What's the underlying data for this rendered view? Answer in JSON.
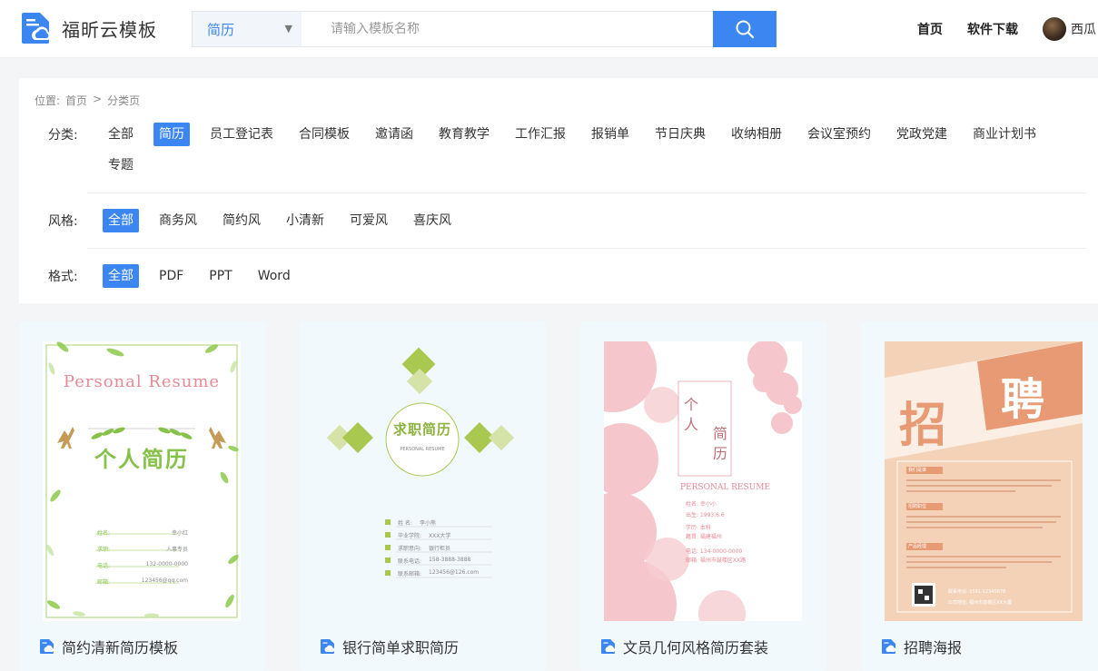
{
  "header": {
    "logo_text": "福昕云模板",
    "search": {
      "category": "简历",
      "placeholder": "请输入模板名称"
    },
    "nav": [
      "首页",
      "软件下载"
    ],
    "username": "西瓜"
  },
  "breadcrumb": {
    "label": "位置:",
    "home": "首页",
    "sep": ">",
    "current": "分类页"
  },
  "filters": {
    "category": {
      "label": "分类:",
      "items": [
        "全部",
        "简历",
        "员工登记表",
        "合同模板",
        "邀请函",
        "教育教学",
        "工作汇报",
        "报销单",
        "节日庆典",
        "收纳相册",
        "会议室预约",
        "党政党建",
        "商业计划书",
        "专题"
      ],
      "active": 1
    },
    "style": {
      "label": "风格:",
      "items": [
        "全部",
        "商务风",
        "简约风",
        "小清新",
        "可爱风",
        "喜庆风"
      ],
      "active": 0
    },
    "format": {
      "label": "格式:",
      "items": [
        "全部",
        "PDF",
        "PPT",
        "Word"
      ],
      "active": 0
    }
  },
  "cards": [
    {
      "title": "简约清新简历模板",
      "thumb": {
        "heading": "Personal Resume",
        "main": "个人简历",
        "rows": [
          [
            "姓名:",
            "幸小红"
          ],
          [
            "求职:",
            "人事专员"
          ],
          [
            "电话:",
            "132-0000-0000"
          ],
          [
            "邮箱:",
            "123456@qq.com"
          ]
        ]
      }
    },
    {
      "title": "银行简单求职简历",
      "thumb": {
        "main": "求职简历",
        "sub": "PERSONAL RESUME",
        "rows": [
          [
            "姓 名:",
            "李小熊"
          ],
          [
            "毕业学院:",
            "XXX大学"
          ],
          [
            "求职意向:",
            "银行柜员"
          ],
          [
            "联系电话:",
            "158-3888-3888"
          ],
          [
            "联系邮箱:",
            "123456@126.com"
          ]
        ]
      }
    },
    {
      "title": "文员几何风格简历套装",
      "thumb": {
        "chars": [
          "个",
          "人",
          "简",
          "历"
        ],
        "heading": "PERSONAL RESUME",
        "rows": [
          "姓名: 幸小小",
          "出生: 1993.6.6",
          "学历: 本科",
          "籍贯: 福建福州",
          "电话: 134-0000-0000",
          "邮箱: 福州市鼓楼区XX路"
        ]
      }
    },
    {
      "title": "招聘海报",
      "thumb": {
        "chars": [
          "招",
          "聘"
        ],
        "sections": [
          "我们是谁",
          "招聘职位",
          "产品经理"
        ],
        "contact": "联系电话: 0591-12345678",
        "address": "公司地址: 福州市鼓楼区XX大厦"
      }
    }
  ],
  "colors": {
    "accent": "#3b86f0",
    "green": "#88c84a",
    "pink": "#e88a95",
    "orange": "#e79a74"
  }
}
